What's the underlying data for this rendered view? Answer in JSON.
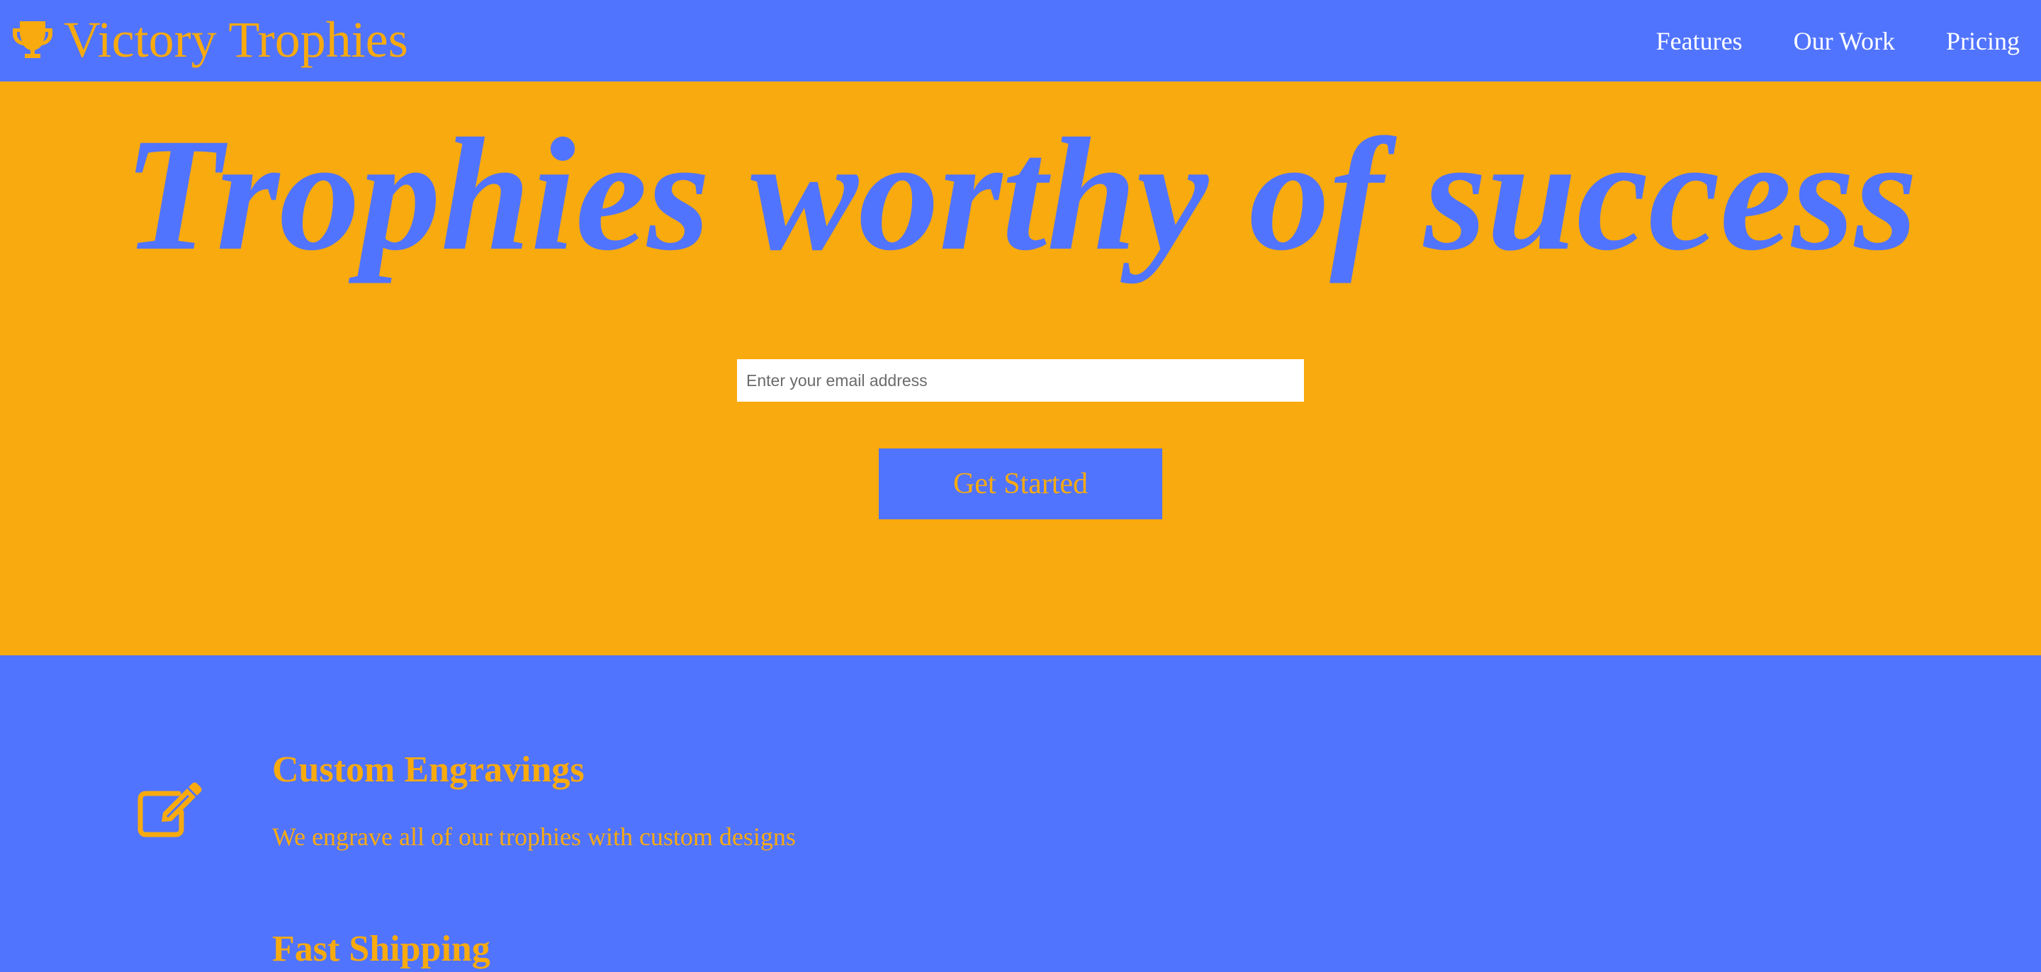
{
  "header": {
    "brand": "Victory Trophies",
    "brand_icon": "trophy-icon",
    "nav": [
      "Features",
      "Our Work",
      "Pricing"
    ]
  },
  "hero": {
    "title": "Trophies worthy of success",
    "email_placeholder": "Enter your email address",
    "cta_label": "Get Started"
  },
  "features": {
    "items": [
      {
        "icon": "edit-icon",
        "title": "Custom Engravings",
        "description": "We engrave all of our trophies with custom designs"
      },
      {
        "title": "Fast Shipping"
      }
    ]
  },
  "colors": {
    "primary_blue": "#5174fe",
    "accent_orange": "#f8aa0e",
    "white": "#ffffff"
  }
}
